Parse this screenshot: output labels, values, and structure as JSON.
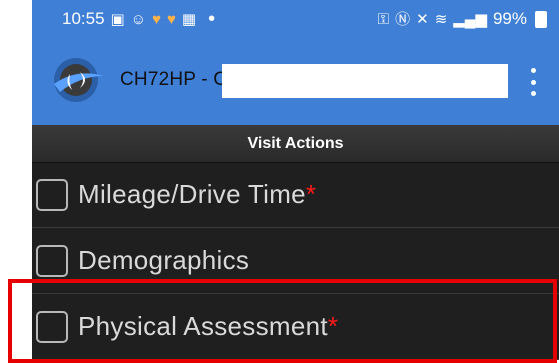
{
  "status_bar": {
    "time": "10:55",
    "left_icons": [
      "app-icon",
      "smiley-icon",
      "orange-heart-icon",
      "orange-heart-icon",
      "calendar-icon"
    ],
    "dot": "•",
    "right_icons": [
      "key-icon",
      "nfc-icon",
      "mute-icon",
      "wifi-icon",
      "signal-icon"
    ],
    "battery": "99%"
  },
  "app_bar": {
    "title": "CH72HP - C",
    "menu_icon": "kebab-menu-icon"
  },
  "section": {
    "header": "Visit Actions"
  },
  "actions": [
    {
      "label": "Mileage/Drive Time",
      "required": "*"
    },
    {
      "label": "Demographics",
      "required": ""
    },
    {
      "label": "Physical Assessment",
      "required": "*"
    }
  ],
  "colors": {
    "accent": "#3f7fd6",
    "background": "#1f1f1f",
    "required": "#ff1a1a",
    "highlight": "#e60000"
  }
}
